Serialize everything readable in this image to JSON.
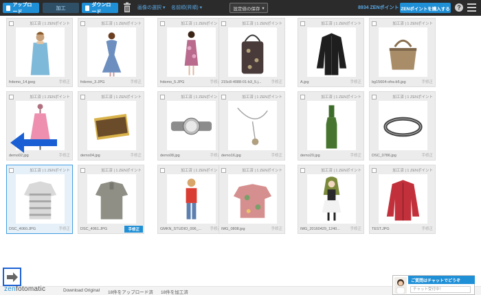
{
  "toolbar": {
    "upload_label": "アップロード",
    "process_label": "加工",
    "download_label": "ダウンロード",
    "select_dropdown": "画像の選択 ▾",
    "sort_dropdown": "名前順(昇順) ▾",
    "save_settings_label": "設定値の保存",
    "points_label": "8934 ZENポイント",
    "buy_points_label": "ZENポイントを購入する",
    "help_label": "?"
  },
  "cards": [
    {
      "meta": "加工済 | 1 ZENポイント",
      "name": "frdemo_14.jpeg",
      "edit": "手修正",
      "icon": "woman-dress-photo"
    },
    {
      "meta": "加工済 | 1 ZENポイント",
      "name": "frdemo_3.JPG",
      "edit": "手修正",
      "icon": "woman-blue-dress-photo"
    },
    {
      "meta": "加工済 | 1 ZENポイント",
      "name": "frdemo_5.JPG",
      "edit": "手修正",
      "icon": "woman-floral-dress-photo"
    },
    {
      "meta": "加工済 | 1 ZENポイント",
      "name": "215c8-4088-01-b3_5.j...",
      "edit": "手修正",
      "icon": "patterned-bag-photo"
    },
    {
      "meta": "加工済 | 1 ZENポイント",
      "name": "A.jpg",
      "edit": "手修正",
      "icon": "black-jacket-photo"
    },
    {
      "meta": "加工済 | 1 ZENポイント",
      "name": "bg15604-ofra-b5.jpg",
      "edit": "手修正",
      "icon": "leather-handbag-photo"
    },
    {
      "meta": "加工済 | 1 ZENポイント",
      "name": "demo02.jpg",
      "edit": "手修正",
      "icon": "pink-dress-mannequin-photo"
    },
    {
      "meta": "加工済 | 1 ZENポイント",
      "name": "demo04.jpg",
      "edit": "手修正",
      "icon": "wallet-photo"
    },
    {
      "meta": "加工済 | 1 ZENポイント",
      "name": "demo08.jpg",
      "edit": "手修正",
      "icon": "watch-photo"
    },
    {
      "meta": "加工済 | 1 ZENポイント",
      "name": "demo16.jpg",
      "edit": "手修正",
      "icon": "necklace-photo"
    },
    {
      "meta": "加工済 | 1 ZENポイント",
      "name": "demo20.jpg",
      "edit": "手修正",
      "icon": "wine-bottle-photo"
    },
    {
      "meta": "加工済 | 1 ZENポイント",
      "name": "DSC_0786.jpg",
      "edit": "手修正",
      "icon": "bracelet-photo"
    },
    {
      "meta": "加工済 | 1 ZENポイント",
      "name": "DSC_4060.JPG",
      "edit": "手修正",
      "icon": "striped-polo-photo"
    },
    {
      "meta": "加工済 | 1 ZENポイント",
      "name": "DSC_4061.JPG",
      "edit": "手修正",
      "icon": "grey-polo-photo"
    },
    {
      "meta": "加工済 | 1 ZENポイント",
      "name": "GMKN_STUDIO_006_...",
      "edit": "手修正",
      "icon": "child-photo"
    },
    {
      "meta": "加工済 | 1 ZENポイント",
      "name": "IMG_0808.jpg",
      "edit": "手修正",
      "icon": "floral-tshirt-photo"
    },
    {
      "meta": "加工済 | 1 ZENポイント",
      "name": "IMG_20160429_1240...",
      "edit": "手修正",
      "icon": "anime-figure-photo"
    },
    {
      "meta": "加工済 | 1 ZENポイント",
      "name": "TEST.JPG",
      "edit": "手修正",
      "icon": "red-jacket-photo"
    }
  ],
  "bottom": {
    "logo_zen": "zen",
    "logo_rest": "fotomatic",
    "download_original": "Download Original",
    "uploaded_count": "18件をアップロード済",
    "processed_count": "18件を加工済"
  },
  "chat": {
    "title": "ご質問はチャットでどうぞ",
    "placeholder": "チャット受付中！"
  },
  "colors": {
    "accent": "#1f8fd6",
    "toolbar": "#2b2b2b",
    "selected_border": "#3f9de0",
    "arrow": "#1a5fd4"
  }
}
